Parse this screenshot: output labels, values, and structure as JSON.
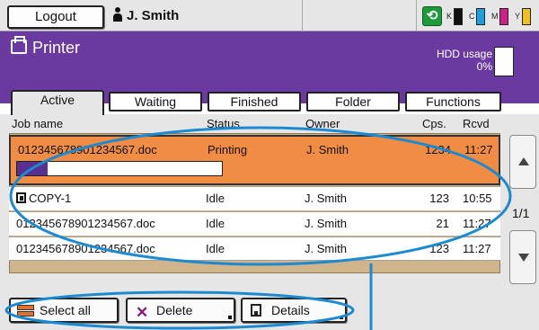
{
  "topbar": {
    "logout_label": "Logout",
    "user_name": "J. Smith",
    "ink": [
      {
        "letter": "K",
        "color": "#111111"
      },
      {
        "letter": "C",
        "color": "#1aa0e0"
      },
      {
        "letter": "M",
        "color": "#d0208a"
      },
      {
        "letter": "Y",
        "color": "#f0c020"
      }
    ]
  },
  "header": {
    "title": "Printer",
    "hdd_label": "HDD usage",
    "hdd_value": "0%"
  },
  "tabs": [
    {
      "label": "Active"
    },
    {
      "label": "Waiting"
    },
    {
      "label": "Finished"
    },
    {
      "label": "Folder"
    },
    {
      "label": "Functions"
    }
  ],
  "columns": {
    "name": "Job name",
    "status": "Status",
    "owner": "Owner",
    "cps": "Cps.",
    "rcvd": "Rcvd"
  },
  "jobs": [
    {
      "name": "012345678901234567.doc",
      "status": "Printing",
      "owner": "J. Smith",
      "cps": "1234",
      "rcvd": "11:27",
      "progress": 0.15
    },
    {
      "name": "COPY-1",
      "status": "Idle",
      "owner": "J. Smith",
      "cps": "123",
      "rcvd": "10:55"
    },
    {
      "name": "012345678901234567.doc",
      "status": "Idle",
      "owner": "J. Smith",
      "cps": "21",
      "rcvd": "11:27"
    },
    {
      "name": "012345678901234567.doc",
      "status": "Idle",
      "owner": "J. Smith",
      "cps": "123",
      "rcvd": "11:27"
    }
  ],
  "pagination": "1/1",
  "buttons": {
    "select_all": "Select all",
    "delete": "Delete",
    "details": "Details"
  },
  "colors": {
    "header_purple": "#6a3aa0",
    "selected_row": "#f08c44",
    "callout_blue": "#1c8ad0"
  }
}
